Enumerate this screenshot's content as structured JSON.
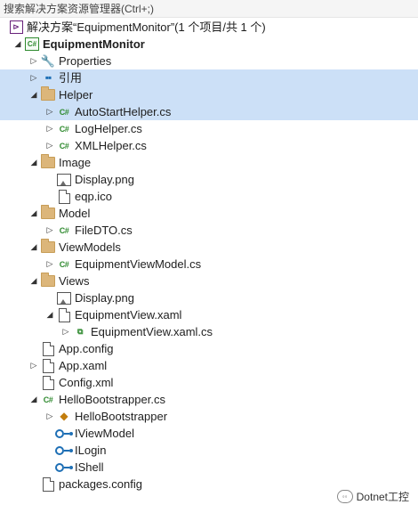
{
  "search": {
    "placeholder": "搜索解决方案资源管理器(Ctrl+;)"
  },
  "colors": {
    "selection": "#cce0f7",
    "csharp": "#2f8a2f",
    "folder": "#dcb67a",
    "interface": "#1e6fb5"
  },
  "tree": [
    {
      "label": "解决方案“EquipmentMonitor”(1 个项目/共 1 个)",
      "icon": "solution-icon",
      "depth": 0,
      "arrow": "none",
      "bold": false
    },
    {
      "label": "EquipmentMonitor",
      "icon": "csharp-project-icon",
      "depth": 1,
      "arrow": "expanded",
      "bold": true
    },
    {
      "label": "Properties",
      "icon": "wrench-icon",
      "depth": 2,
      "arrow": "collapsed"
    },
    {
      "label": "引用",
      "icon": "references-icon",
      "depth": 2,
      "arrow": "collapsed",
      "selected": true
    },
    {
      "label": "Helper",
      "icon": "folder-open-icon",
      "depth": 2,
      "arrow": "expanded",
      "selected": true
    },
    {
      "label": "AutoStartHelper.cs",
      "icon": "csharp-file-icon",
      "depth": 3,
      "arrow": "collapsed",
      "selected": true
    },
    {
      "label": "LogHelper.cs",
      "icon": "csharp-file-icon",
      "depth": 3,
      "arrow": "collapsed"
    },
    {
      "label": "XMLHelper.cs",
      "icon": "csharp-file-icon",
      "depth": 3,
      "arrow": "collapsed"
    },
    {
      "label": "Image",
      "icon": "folder-open-icon",
      "depth": 2,
      "arrow": "expanded"
    },
    {
      "label": "Display.png",
      "icon": "image-file-icon",
      "depth": 3,
      "arrow": "none"
    },
    {
      "label": "eqp.ico",
      "icon": "ico-file-icon",
      "depth": 3,
      "arrow": "none"
    },
    {
      "label": "Model",
      "icon": "folder-open-icon",
      "depth": 2,
      "arrow": "expanded"
    },
    {
      "label": "FileDTO.cs",
      "icon": "csharp-file-icon",
      "depth": 3,
      "arrow": "collapsed"
    },
    {
      "label": "ViewModels",
      "icon": "folder-open-icon",
      "depth": 2,
      "arrow": "expanded"
    },
    {
      "label": "EquipmentViewModel.cs",
      "icon": "csharp-file-icon",
      "depth": 3,
      "arrow": "collapsed"
    },
    {
      "label": "Views",
      "icon": "folder-open-icon",
      "depth": 2,
      "arrow": "expanded"
    },
    {
      "label": "Display.png",
      "icon": "image-file-icon",
      "depth": 3,
      "arrow": "none"
    },
    {
      "label": "EquipmentView.xaml",
      "icon": "xaml-file-icon",
      "depth": 3,
      "arrow": "expanded"
    },
    {
      "label": "EquipmentView.xaml.cs",
      "icon": "csharp-codebehind-icon",
      "depth": 4,
      "arrow": "collapsed"
    },
    {
      "label": "App.config",
      "icon": "config-file-icon",
      "depth": 2,
      "arrow": "none"
    },
    {
      "label": "App.xaml",
      "icon": "xaml-file-icon",
      "depth": 2,
      "arrow": "collapsed"
    },
    {
      "label": "Config.xml",
      "icon": "xml-file-icon",
      "depth": 2,
      "arrow": "none"
    },
    {
      "label": "HelloBootstrapper.cs",
      "icon": "csharp-file-icon",
      "depth": 2,
      "arrow": "expanded"
    },
    {
      "label": "HelloBootstrapper",
      "icon": "class-icon",
      "depth": 3,
      "arrow": "collapsed"
    },
    {
      "label": "IViewModel",
      "icon": "interface-icon",
      "depth": 3,
      "arrow": "none"
    },
    {
      "label": "ILogin",
      "icon": "interface-icon",
      "depth": 3,
      "arrow": "none"
    },
    {
      "label": "IShell",
      "icon": "interface-icon",
      "depth": 3,
      "arrow": "none"
    },
    {
      "label": "packages.config",
      "icon": "config-file-icon",
      "depth": 2,
      "arrow": "none"
    }
  ],
  "watermark": {
    "text": "Dotnet工控"
  }
}
